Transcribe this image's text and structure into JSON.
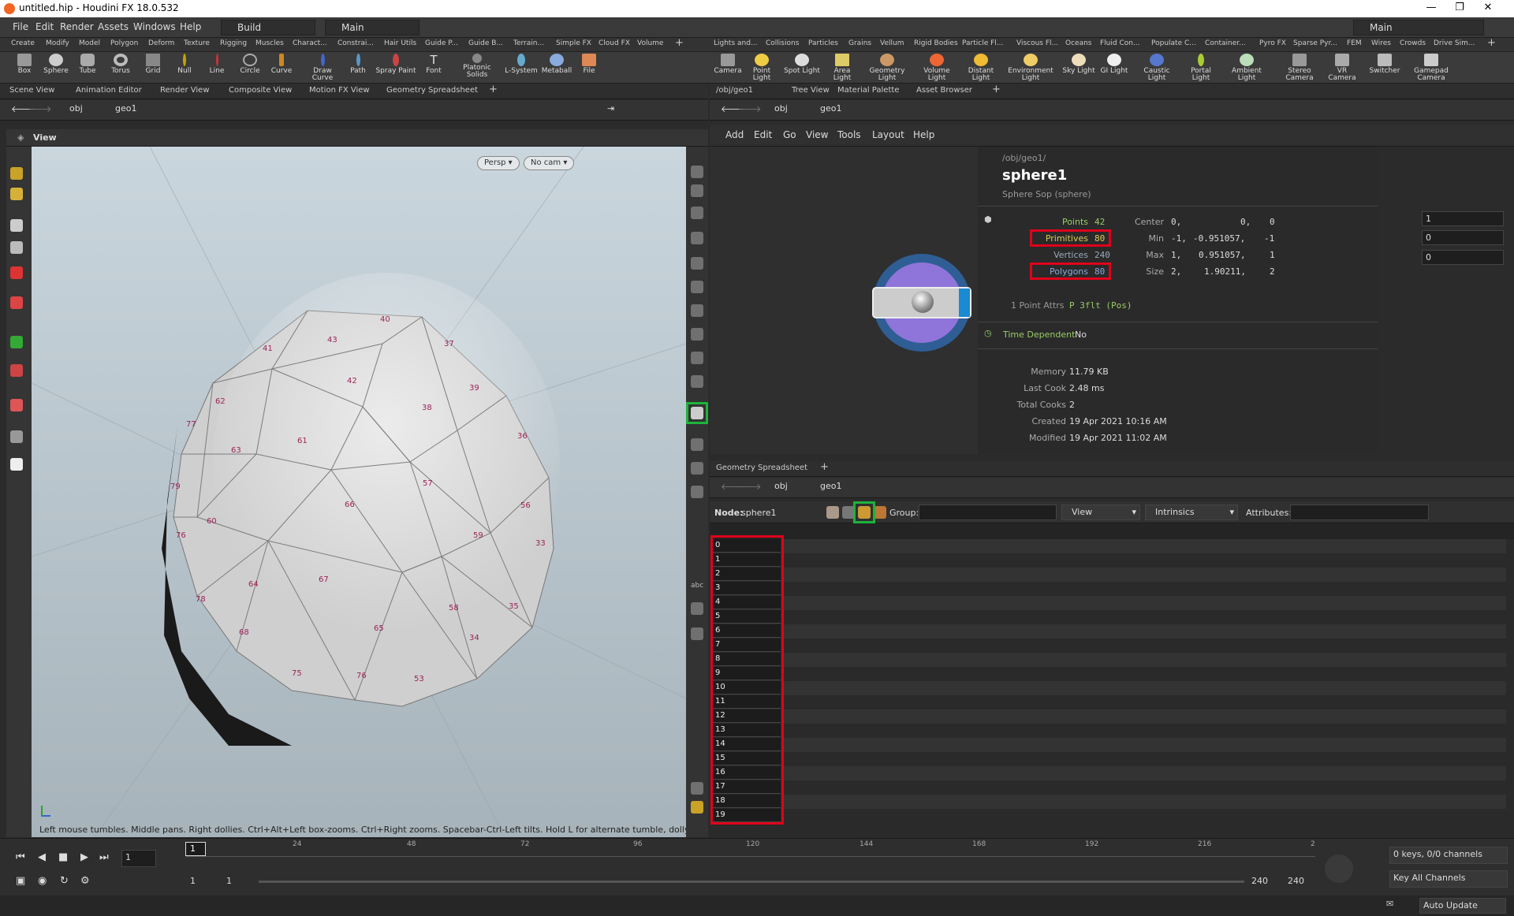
{
  "window": {
    "title": "untitled.hip - Houdini FX 18.0.532"
  },
  "menubar": {
    "items": [
      "File",
      "Edit",
      "Render",
      "Assets",
      "Windows",
      "Help"
    ],
    "desktop": "Build",
    "network": "Main",
    "right_desktop": "Main"
  },
  "shelf_left": {
    "tabs": [
      "Create",
      "Modify",
      "Model",
      "Polygon",
      "Deform",
      "Texture",
      "Rigging",
      "Muscles",
      "Charact...",
      "Constrai...",
      "Hair Utils",
      "Guide P...",
      "Guide B...",
      "Terrain...",
      "Simple FX",
      "Cloud FX",
      "Volume"
    ],
    "tools": [
      "Box",
      "Sphere",
      "Tube",
      "Torus",
      "Grid",
      "Null",
      "Line",
      "Circle",
      "Curve",
      "Draw Curve",
      "Path",
      "Spray Paint",
      "Font",
      "Platonic Solids",
      "L-System",
      "Metaball",
      "File"
    ]
  },
  "shelf_right": {
    "tabs": [
      "Lights and...",
      "Collisions",
      "Particles",
      "Grains",
      "Vellum",
      "Rigid Bodies",
      "Particle Fl...",
      "Viscous Fl...",
      "Oceans",
      "Fluid Con...",
      "Populate C...",
      "Container...",
      "Pyro FX",
      "Sparse Pyr...",
      "FEM",
      "Wires",
      "Crowds",
      "Drive Sim..."
    ],
    "tools": [
      "Camera",
      "Point Light",
      "Spot Light",
      "Area Light",
      "Geometry Light",
      "Volume Light",
      "Distant Light",
      "Environment Light",
      "Sky Light",
      "GI Light",
      "Caustic Light",
      "Portal Light",
      "Ambient Light",
      "Stereo Camera",
      "VR Camera",
      "Switcher",
      "Gamepad Camera"
    ]
  },
  "left_pane": {
    "tabs": [
      "Scene View",
      "Animation Editor",
      "Render View",
      "Composite View",
      "Motion FX View",
      "Geometry Spreadsheet"
    ],
    "path": [
      "obj",
      "geo1"
    ],
    "view_label": "View",
    "persp": "Persp",
    "cam": "No cam",
    "hint": "Left mouse tumbles. Middle pans. Right dollies. Ctrl+Alt+Left box-zooms. Ctrl+Right zooms. Spacebar-Ctrl-Left tilts. Hold L for alternate tumble, dolly, and zoom.",
    "point_numbers": [
      "40",
      "43",
      "37",
      "41",
      "42",
      "39",
      "62",
      "38",
      "36",
      "77",
      "63",
      "61",
      "57",
      "79",
      "66",
      "56",
      "60",
      "59",
      "76",
      "33",
      "64",
      "67",
      "58",
      "35",
      "78",
      "65",
      "34",
      "68",
      "75",
      "76",
      "53"
    ]
  },
  "network_pane": {
    "tabs": [
      "/obj/geo1",
      "Tree View",
      "Material Palette",
      "Asset Browser"
    ],
    "path": [
      "obj",
      "geo1"
    ],
    "menus": [
      "Add",
      "Edit",
      "Go",
      "View",
      "Tools",
      "Layout",
      "Help"
    ],
    "param_values": [
      "1",
      "0",
      "0"
    ]
  },
  "info": {
    "path": "/obj/geo1/",
    "node_name": "sphere1",
    "node_type": "Sphere Sop (sphere)",
    "points_label": "Points",
    "points": "42",
    "primitives_label": "Primitives",
    "primitives": "80",
    "vertices_label": "Vertices",
    "vertices": "240",
    "polygons_label": "Polygons",
    "polygons": "80",
    "center_label": "Center",
    "center": [
      "0,",
      "0,",
      "0"
    ],
    "min_label": "Min",
    "min": [
      "-1,",
      "-0.951057,",
      "-1"
    ],
    "max_label": "Max",
    "max": [
      "1,",
      "0.951057,",
      "1"
    ],
    "size_label": "Size",
    "size": [
      "2,",
      "1.90211,",
      "2"
    ],
    "point_attrs": "1 Point Attrs",
    "point_attrs_detail": "P 3flt (Pos)",
    "time_dep_label": "Time Dependent",
    "time_dep": "No",
    "memory_label": "Memory",
    "memory": "11.79 KB",
    "lastcook_label": "Last Cook",
    "lastcook": "2.48 ms",
    "totalcooks_label": "Total Cooks",
    "totalcooks": "2",
    "created_label": "Created",
    "created": "19 Apr 2021 10:16 AM",
    "modified_label": "Modified",
    "modified": "19 Apr 2021 11:02 AM"
  },
  "spreadsheet": {
    "tab": "Geometry Spreadsheet",
    "path": [
      "obj",
      "geo1"
    ],
    "node_label": "Node:",
    "node": "sphere1",
    "group_label": "Group:",
    "view": "View",
    "intrinsics": "Intrinsics",
    "attributes_label": "Attributes:",
    "rows": [
      "0",
      "1",
      "2",
      "3",
      "4",
      "5",
      "6",
      "7",
      "8",
      "9",
      "10",
      "11",
      "12",
      "13",
      "14",
      "15",
      "16",
      "17",
      "18",
      "19"
    ]
  },
  "timeline": {
    "frame": "1",
    "ticks": [
      "24",
      "48",
      "72",
      "96",
      "120",
      "144",
      "168",
      "192",
      "216",
      "2"
    ],
    "start": "1",
    "start2": "1",
    "end": "240",
    "end2": "240",
    "keys": "0 keys, 0/0 channels",
    "key_all": "Key All Channels",
    "auto_update": "Auto Update"
  },
  "colors": {
    "highlight_red": "#e0001b",
    "highlight_green": "#1db33b",
    "point_number": "#9c2257"
  }
}
